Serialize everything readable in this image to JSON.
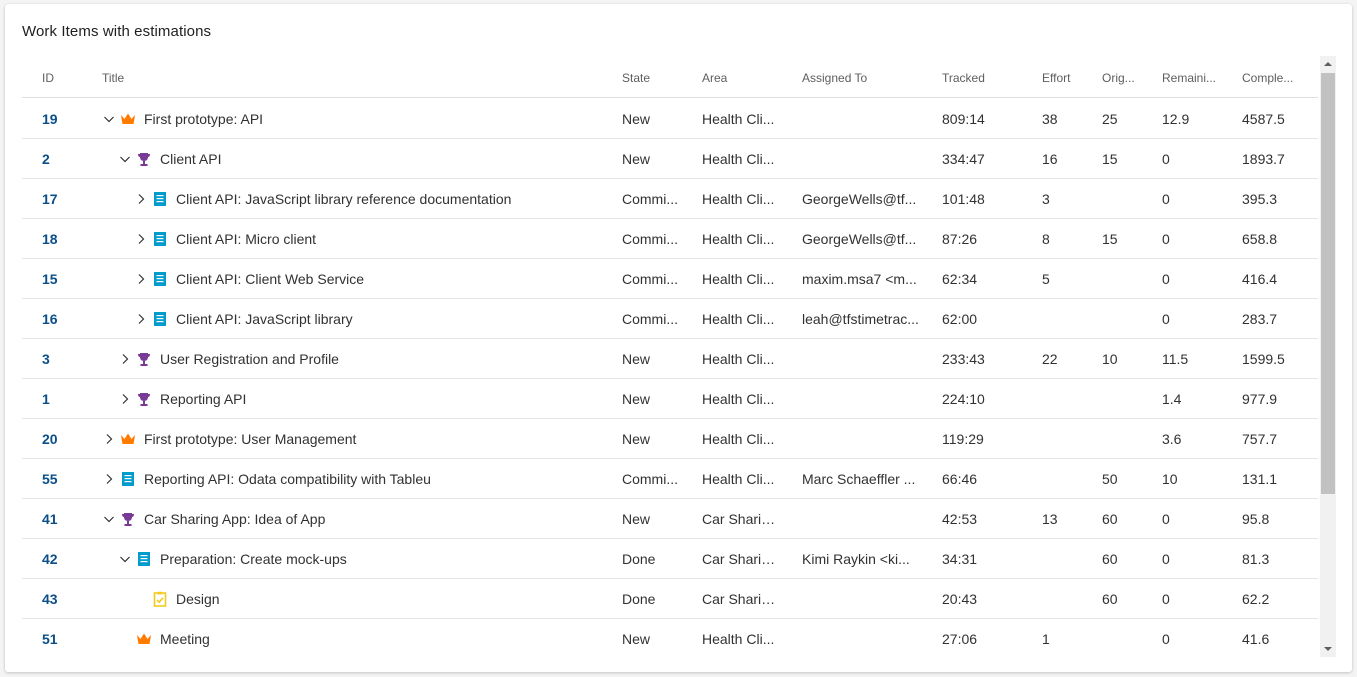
{
  "widget": {
    "title": "Work Items with estimations"
  },
  "columns": {
    "id": "ID",
    "title": "Title",
    "state": "State",
    "area": "Area",
    "assigned": "Assigned To",
    "tracked": "Tracked",
    "effort": "Effort",
    "original": "Orig...",
    "remaining": "Remaini...",
    "completed": "Comple..."
  },
  "colors": {
    "epic": "#ff7b00",
    "feature": "#773b93",
    "story": "#009ccc",
    "task": "#f2cb1d",
    "id_text": "#0b4f8a"
  },
  "rows": [
    {
      "id": "19",
      "level": 0,
      "expander": "expanded",
      "icon": "crown-icon",
      "title": "First prototype: API",
      "state": "New",
      "area": "Health Cli...",
      "assigned": "",
      "tracked": "809:14",
      "effort": "38",
      "original": "25",
      "remaining": "12.9",
      "completed": "4587.5"
    },
    {
      "id": "2",
      "level": 1,
      "expander": "expanded",
      "icon": "trophy-icon",
      "title": "Client API",
      "state": "New",
      "area": "Health Cli...",
      "assigned": "",
      "tracked": "334:47",
      "effort": "16",
      "original": "15",
      "remaining": "0",
      "completed": "1893.7"
    },
    {
      "id": "17",
      "level": 2,
      "expander": "collapsed",
      "icon": "book-icon",
      "title": "Client API: JavaScript library reference documentation",
      "state": "Commi...",
      "area": "Health Cli...",
      "assigned": "GeorgeWells@tf...",
      "tracked": "101:48",
      "effort": "3",
      "original": "",
      "remaining": "0",
      "completed": "395.3"
    },
    {
      "id": "18",
      "level": 2,
      "expander": "collapsed",
      "icon": "book-icon",
      "title": "Client API: Micro client",
      "state": "Commi...",
      "area": "Health Cli...",
      "assigned": "GeorgeWells@tf...",
      "tracked": "87:26",
      "effort": "8",
      "original": "15",
      "remaining": "0",
      "completed": "658.8"
    },
    {
      "id": "15",
      "level": 2,
      "expander": "collapsed",
      "icon": "book-icon",
      "title": "Client API: Client Web Service",
      "state": "Commi...",
      "area": "Health Cli...",
      "assigned": "maxim.msa7 <m...",
      "tracked": "62:34",
      "effort": "5",
      "original": "",
      "remaining": "0",
      "completed": "416.4"
    },
    {
      "id": "16",
      "level": 2,
      "expander": "collapsed",
      "icon": "book-icon",
      "title": "Client API: JavaScript library",
      "state": "Commi...",
      "area": "Health Cli...",
      "assigned": "leah@tfstimetrac...",
      "tracked": "62:00",
      "effort": "",
      "original": "",
      "remaining": "0",
      "completed": "283.7"
    },
    {
      "id": "3",
      "level": 1,
      "expander": "collapsed",
      "icon": "trophy-icon",
      "title": "User Registration and Profile",
      "state": "New",
      "area": "Health Cli...",
      "assigned": "",
      "tracked": "233:43",
      "effort": "22",
      "original": "10",
      "remaining": "11.5",
      "completed": "1599.5"
    },
    {
      "id": "1",
      "level": 1,
      "expander": "collapsed",
      "icon": "trophy-icon",
      "title": "Reporting API",
      "state": "New",
      "area": "Health Cli...",
      "assigned": "",
      "tracked": "224:10",
      "effort": "",
      "original": "",
      "remaining": "1.4",
      "completed": "977.9"
    },
    {
      "id": "20",
      "level": 0,
      "expander": "collapsed",
      "icon": "crown-icon",
      "title": "First prototype: User Management",
      "state": "New",
      "area": "Health Cli...",
      "assigned": "",
      "tracked": "119:29",
      "effort": "",
      "original": "",
      "remaining": "3.6",
      "completed": "757.7"
    },
    {
      "id": "55",
      "level": 0,
      "expander": "collapsed",
      "icon": "book-icon",
      "title": "Reporting API: Odata compatibility with Tableu",
      "state": "Commi...",
      "area": "Health Cli...",
      "assigned": "Marc Schaeffler ...",
      "tracked": "66:46",
      "effort": "",
      "original": "50",
      "remaining": "10",
      "completed": "131.1"
    },
    {
      "id": "41",
      "level": 0,
      "expander": "expanded",
      "icon": "trophy-icon",
      "title": "Car Sharing App: Idea of App",
      "state": "New",
      "area": "Car Sharin...",
      "assigned": "",
      "tracked": "42:53",
      "effort": "13",
      "original": "60",
      "remaining": "0",
      "completed": "95.8"
    },
    {
      "id": "42",
      "level": 1,
      "expander": "expanded",
      "icon": "book-icon",
      "title": "Preparation: Create mock-ups",
      "state": "Done",
      "area": "Car Sharin...",
      "assigned": "Kimi Raykin <ki...",
      "tracked": "34:31",
      "effort": "",
      "original": "60",
      "remaining": "0",
      "completed": "81.3"
    },
    {
      "id": "43",
      "level": 2,
      "expander": "none",
      "icon": "clipboard-icon",
      "title": "Design",
      "state": "Done",
      "area": "Car Sharin...",
      "assigned": "",
      "tracked": "20:43",
      "effort": "",
      "original": "60",
      "remaining": "0",
      "completed": "62.2"
    },
    {
      "id": "51",
      "level": 1,
      "expander": "none",
      "icon": "crown-icon",
      "title": "Meeting",
      "state": "New",
      "area": "Health Cli...",
      "assigned": "",
      "tracked": "27:06",
      "effort": "1",
      "original": "",
      "remaining": "0",
      "completed": "41.6"
    }
  ]
}
